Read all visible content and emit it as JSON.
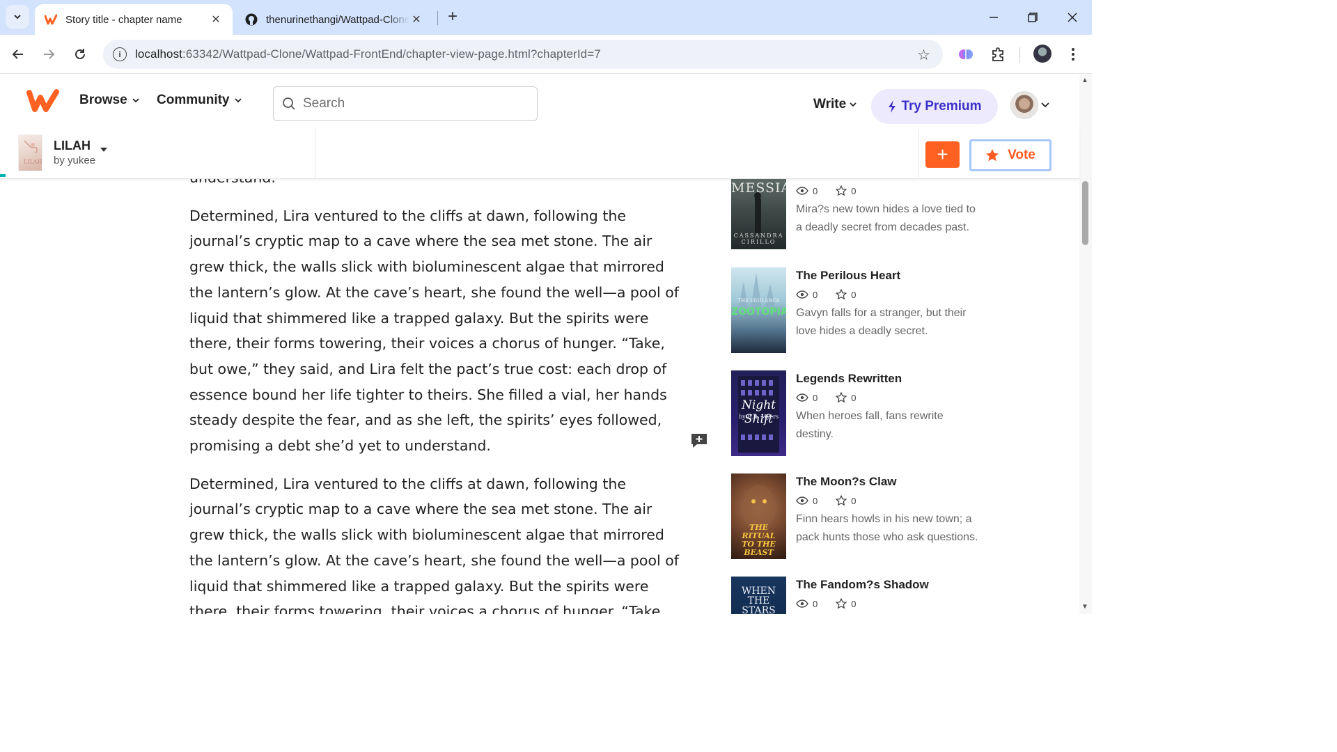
{
  "browser": {
    "tabs": [
      {
        "title": "Story title - chapter name",
        "active": true
      },
      {
        "title": "thenurinethangi/Wattpad-Clone",
        "active": false
      }
    ],
    "url_host": "localhost",
    "url_path": ":63342/Wattpad-Clone/Wattpad-FrontEnd/chapter-view-page.html?chapterId=7"
  },
  "header": {
    "nav": [
      "Browse",
      "Community"
    ],
    "search_placeholder": "Search",
    "write_label": "Write",
    "premium_label": "Try Premium"
  },
  "story": {
    "title": "LILAH",
    "author": "by yukee",
    "cover_mark": "LILAH",
    "vote_label": "Vote",
    "add_label": "+"
  },
  "chapter": {
    "paragraphs": [
      "understand.",
      "Determined, Lira ventured to the cliffs at dawn, following the journal’s cryptic map to a cave where the sea met stone. The air grew thick, the walls slick with bioluminescent algae that mirrored the lantern’s glow. At the cave’s heart, she found the well—a pool of liquid that shimmered like a trapped galaxy. But the spirits were there, their forms towering, their voices a chorus of hunger. “Take, but owe,” they said, and Lira felt the pact’s true cost: each drop of essence bound her life tighter to theirs. She filled a vial, her hands steady despite the fear, and as she left, the spirits’ eyes followed, promising a debt she’d yet to understand.",
      "Determined, Lira ventured to the cliffs at dawn, following the journal’s cryptic map to a cave where the sea met stone. The air grew thick, the walls slick with bioluminescent algae that mirrored the lantern’s glow. At the cave’s heart, she found the well—a pool of liquid that shimmered like a trapped galaxy. But the spirits were there, their forms towering, their voices a chorus of hunger. “Take, but owe,” they said, and Lira felt the pact’s true cost: each drop of essence bound her life tighter to theirs."
    ]
  },
  "recommendations": [
    {
      "title": "",
      "reads": "0",
      "votes": "0",
      "desc": "Mira?s new town hides a love tied to a deadly secret from decades past.",
      "cover_text": "MESSIAH",
      "cover_sub": "CASSANDRA CIRILLO"
    },
    {
      "title": "The Perilous Heart",
      "reads": "0",
      "votes": "0",
      "desc": "Gavyn falls for a stranger, but their love hides a deadly secret.",
      "cover_text": "ZOOTOPIA",
      "cover_sub": "THE VIGILANCE"
    },
    {
      "title": "Legends Rewritten",
      "reads": "0",
      "votes": "0",
      "desc": "When heroes fall, fans rewrite destiny.",
      "cover_text": "Night Shift",
      "cover_sub": "by B.R. Myers"
    },
    {
      "title": "The Moon?s Claw",
      "reads": "0",
      "votes": "0",
      "desc": "Finn hears howls in his new town; a pack hunts those who ask questions.",
      "cover_text": "THE RITUAL TO THE BEAST",
      "cover_sub": ""
    },
    {
      "title": "The Fandom?s Shadow",
      "reads": "0",
      "votes": "0",
      "desc": "",
      "cover_text": "WHEN THE STARS",
      "cover_sub": ""
    }
  ],
  "colors": {
    "brand": "#ff6122",
    "premium": "#3b2fc9",
    "progress": "#00b2b2"
  }
}
